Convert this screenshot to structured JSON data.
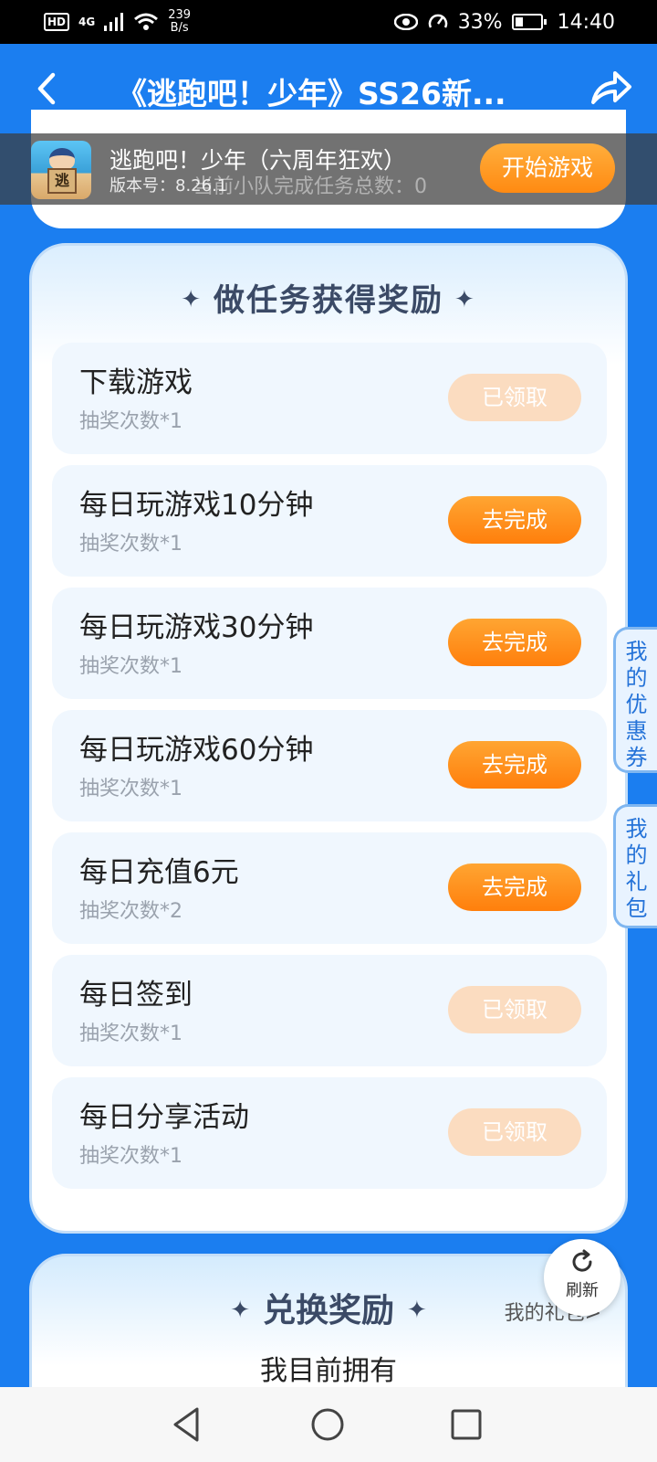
{
  "status_bar": {
    "hd": "HD",
    "network": "4G",
    "speed_value": "239",
    "speed_unit": "B/s",
    "battery": "33%",
    "time": "14:40"
  },
  "header": {
    "title": "《逃跑吧！少年》SS26新..."
  },
  "game_bar": {
    "name": "逃跑吧！少年（六周年狂欢）",
    "version": "版本号：8.26.1",
    "behind_text": "当前小队完成任务总数：0",
    "icon_text": "逃",
    "start_label": "开始游戏"
  },
  "tasks": {
    "title": "做任务获得奖励",
    "items": [
      {
        "name": "下载游戏",
        "sub": "抽奖次数*1",
        "btn": "已领取",
        "state": "done"
      },
      {
        "name": "每日玩游戏10分钟",
        "sub": "抽奖次数*1",
        "btn": "去完成",
        "state": "go"
      },
      {
        "name": "每日玩游戏30分钟",
        "sub": "抽奖次数*1",
        "btn": "去完成",
        "state": "go"
      },
      {
        "name": "每日玩游戏60分钟",
        "sub": "抽奖次数*1",
        "btn": "去完成",
        "state": "go"
      },
      {
        "name": "每日充值6元",
        "sub": "抽奖次数*2",
        "btn": "去完成",
        "state": "go"
      },
      {
        "name": "每日签到",
        "sub": "抽奖次数*1",
        "btn": "已领取",
        "state": "done"
      },
      {
        "name": "每日分享活动",
        "sub": "抽奖次数*1",
        "btn": "已领取",
        "state": "done"
      }
    ]
  },
  "side_tabs": {
    "coupons": "我的优惠券",
    "gifts": "我的礼包"
  },
  "redeem": {
    "title": "兑换奖励",
    "my_gifts": "我的礼包>",
    "owned": "我目前拥有"
  },
  "refresh": {
    "label": "刷新"
  },
  "colors": {
    "primary_blue": "#1b7ef0",
    "orange": "#ff8a12",
    "done_button": "#fbdcc0"
  }
}
